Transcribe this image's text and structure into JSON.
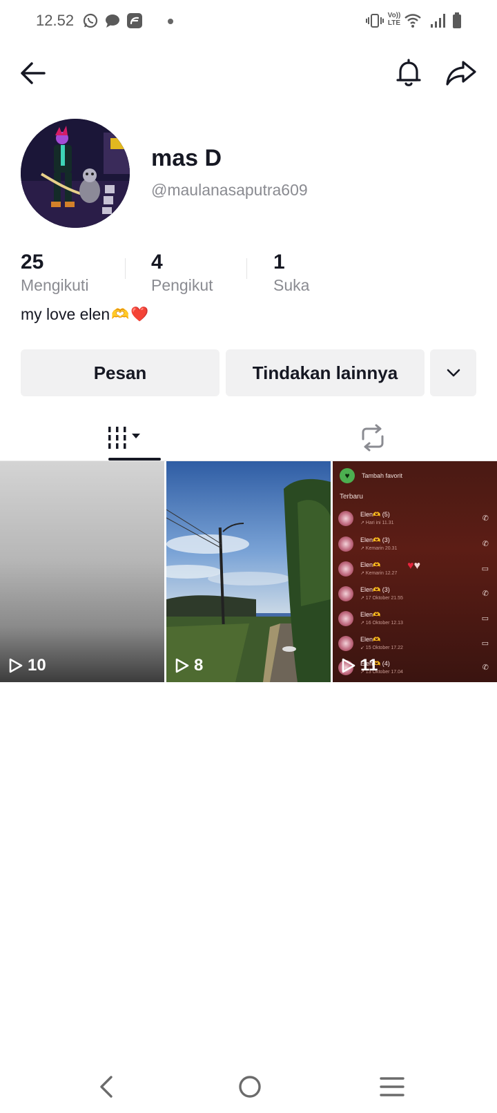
{
  "status_bar": {
    "time": "12.52",
    "left_icons": [
      "whatsapp-icon",
      "message-bubble-icon",
      "app-notification-icon"
    ],
    "right_icons": [
      "vibrate-icon",
      "volte-icon",
      "wifi-icon",
      "signal-icon",
      "battery-icon"
    ],
    "volte_label_top": "Vo))",
    "volte_label_bottom": "LTE"
  },
  "profile": {
    "display_name": "mas D",
    "username": "@maulanasaputra609",
    "bio_text": "my love elen",
    "bio_emojis": [
      "🫶",
      "❤️"
    ]
  },
  "stats": [
    {
      "value": "25",
      "label": "Mengikuti"
    },
    {
      "value": "4",
      "label": "Pengikut"
    },
    {
      "value": "1",
      "label": "Suka"
    }
  ],
  "actions": {
    "message_label": "Pesan",
    "more_label": "Tindakan lainnya"
  },
  "tabs": [
    {
      "name": "videos",
      "icon": "grid-icon",
      "selected": true
    },
    {
      "name": "reposts",
      "icon": "repost-icon",
      "selected": false
    }
  ],
  "videos": [
    {
      "views": "10"
    },
    {
      "views": "8"
    },
    {
      "views": "11"
    }
  ],
  "thumbnail_3": {
    "header": "Tambah favorit",
    "section": "Terbaru",
    "entries": [
      {
        "name": "Elen🫶 (5)",
        "sub": "↗ Hari ini 11.31",
        "call": "phone"
      },
      {
        "name": "Elen🫶 (3)",
        "sub": "↗ Kemarin 20.31",
        "call": "phone"
      },
      {
        "name": "Elen🫶",
        "sub": "↗ Kemarin 12.27",
        "call": "video"
      },
      {
        "name": "Elen🫶 (3)",
        "sub": "↗ 17 Oktober 21.55",
        "call": "phone"
      },
      {
        "name": "Elen🫶",
        "sub": "↗ 16 Oktober 12.13",
        "call": "video"
      },
      {
        "name": "Elen🫶",
        "sub": "↙ 15 Oktober 17.22",
        "call": "video"
      },
      {
        "name": "Elen🫶 (4)",
        "sub": "↗ 13 Oktober 17.04",
        "call": "phone"
      }
    ]
  },
  "colors": {
    "text_primary": "#161823",
    "text_secondary": "#8a8b91",
    "button_bg": "#f1f1f2",
    "accent_heart": "#e8243d"
  }
}
